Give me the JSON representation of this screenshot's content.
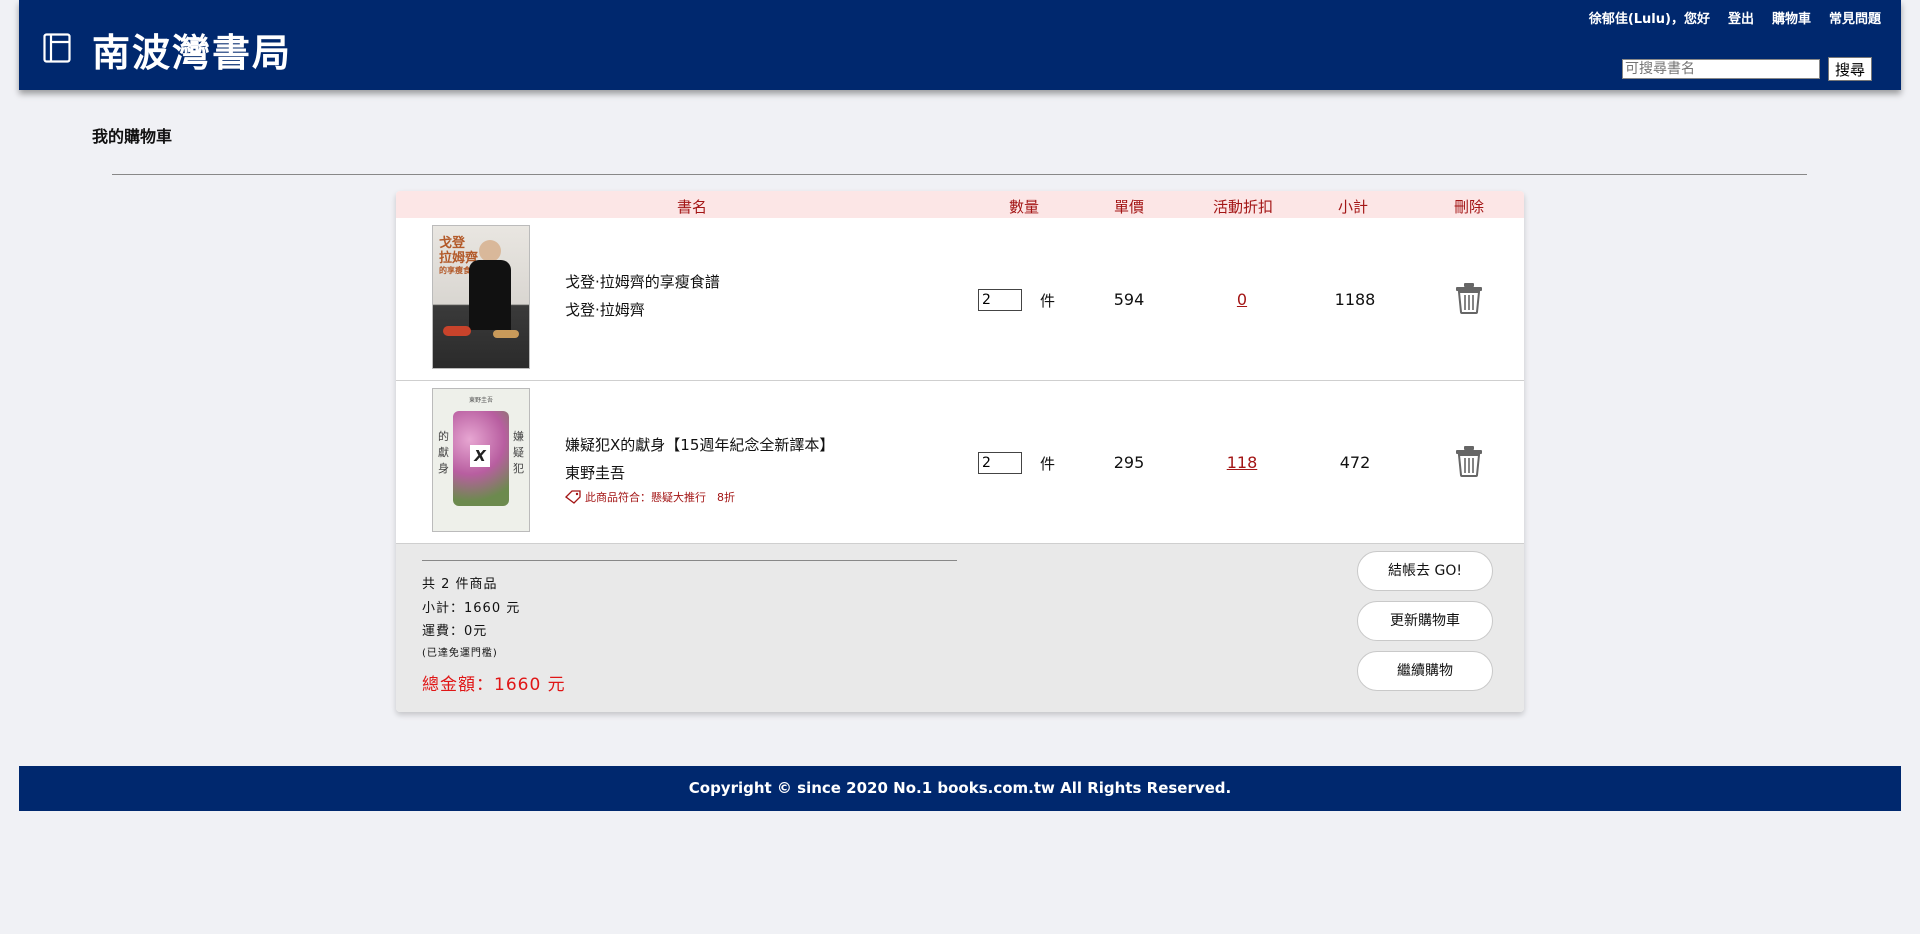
{
  "header": {
    "title": "南波灣書局",
    "nav": {
      "greeting": "徐郁佳(Lulu)，您好",
      "logout": "登出",
      "cart": "購物車",
      "faq": "常見問題"
    },
    "search": {
      "placeholder": "可搜尋書名",
      "button": "搜尋"
    },
    "colors": {
      "brand": "#00286e",
      "accent": "#a31515"
    }
  },
  "page": {
    "heading": "我的購物車"
  },
  "cart": {
    "columns": {
      "title": "書名",
      "qty": "數量",
      "price": "單價",
      "discount": "活動折扣",
      "subtotal": "小計",
      "delete": "刪除"
    },
    "qty_unit": "件",
    "items": [
      {
        "title": "戈登·拉姆齊的享瘦食譜",
        "author": "戈登·拉姆齊",
        "cover_text": [
          "戈登",
          "拉姆齊",
          "的享瘦食譜"
        ],
        "qty": "2",
        "price": "594",
        "discount": "0",
        "subtotal": "1188",
        "promo": ""
      },
      {
        "title": "嫌疑犯X的獻身【15週年紀念全新譯本】",
        "author": "東野圭吾",
        "cover_text": [
          "東野圭吾",
          "嫌疑犯",
          "的獻身",
          "X"
        ],
        "qty": "2",
        "price": "295",
        "discount": "118",
        "subtotal": "472",
        "promo": "此商品符合：懸疑大推行　8折"
      }
    ],
    "summary": {
      "count": "共 2 件商品",
      "subtotal": "小計：1660 元",
      "shipping": "運費：0元",
      "shipping_note": "(已達免運門檻)",
      "total": "總金額：1660 元"
    },
    "buttons": {
      "checkout": "結帳去 GO!",
      "update": "更新購物車",
      "continue": "繼續購物"
    }
  },
  "footer": {
    "text": "Copyright © since 2020 No.1 books.com.tw All Rights Reserved."
  }
}
